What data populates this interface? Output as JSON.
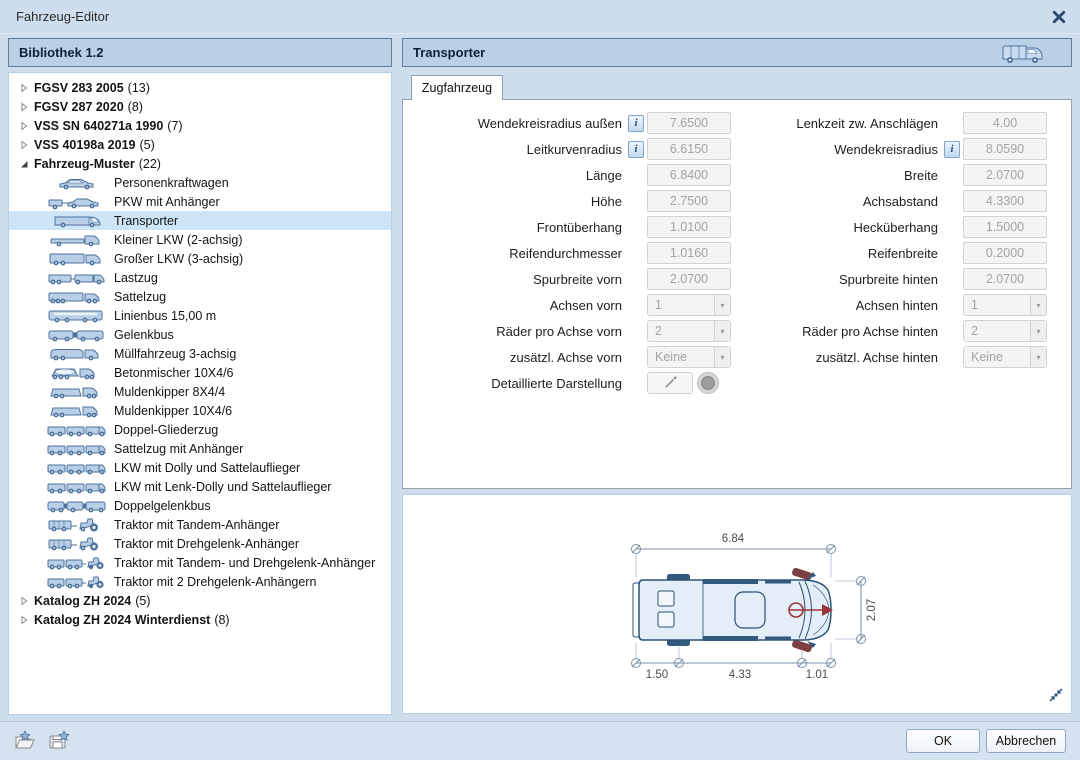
{
  "window": {
    "title": "Fahrzeug-Editor"
  },
  "library": {
    "header": "Bibliothek 1.2",
    "tree": [
      {
        "label": "FGSV 283 2005",
        "count": "(13)",
        "expanded": false
      },
      {
        "label": "FGSV 287 2020",
        "count": "(8)",
        "expanded": false
      },
      {
        "label": "VSS SN 640271a 1990",
        "count": "(7)",
        "expanded": false
      },
      {
        "label": "VSS 40198a 2019",
        "count": "(5)",
        "expanded": false
      },
      {
        "label": "Fahrzeug-Muster",
        "count": "(22)",
        "expanded": true,
        "children": [
          {
            "label": "Personenkraftwagen",
            "icon": "car-icon"
          },
          {
            "label": "PKW mit Anhänger",
            "icon": "car-trailer-icon"
          },
          {
            "label": "Transporter",
            "icon": "van-icon",
            "selected": true
          },
          {
            "label": "Kleiner LKW (2-achsig)",
            "icon": "small-truck-icon"
          },
          {
            "label": "Großer LKW (3-achsig)",
            "icon": "large-truck-icon"
          },
          {
            "label": "Lastzug",
            "icon": "truck-trailer-icon"
          },
          {
            "label": "Sattelzug",
            "icon": "semi-truck-icon"
          },
          {
            "label": "Linienbus 15,00 m",
            "icon": "bus-icon"
          },
          {
            "label": "Gelenkbus",
            "icon": "articulated-bus-icon"
          },
          {
            "label": "Müllfahrzeug 3-achsig",
            "icon": "garbage-truck-icon"
          },
          {
            "label": "Betonmischer 10X4/6",
            "icon": "concrete-mixer-icon"
          },
          {
            "label": "Muldenkipper 8X4/4",
            "icon": "dump-truck-icon"
          },
          {
            "label": "Muldenkipper 10X4/6",
            "icon": "dump-truck-icon"
          },
          {
            "label": "Doppel-Gliederzug",
            "icon": "double-road-train-icon"
          },
          {
            "label": "Sattelzug  mit Anhänger",
            "icon": "double-road-train-icon"
          },
          {
            "label": "LKW mit Dolly und Sattelauflieger",
            "icon": "double-road-train-icon"
          },
          {
            "label": "LKW mit Lenk-Dolly und Sattelauflieger",
            "icon": "double-road-train-icon"
          },
          {
            "label": "Doppelgelenkbus",
            "icon": "double-articulated-bus-icon"
          },
          {
            "label": "Traktor mit Tandem-Anhänger",
            "icon": "tractor-trailer-icon"
          },
          {
            "label": "Traktor mit Drehgelenk-Anhänger",
            "icon": "tractor-trailer-icon"
          },
          {
            "label": "Traktor mit Tandem- und Drehgelenk-Anhänger",
            "icon": "tractor-two-trailers-icon"
          },
          {
            "label": "Traktor mit 2 Drehgelenk-Anhängern",
            "icon": "tractor-two-trailers-icon"
          }
        ]
      },
      {
        "label": "Katalog ZH 2024",
        "count": "(5)",
        "expanded": false
      },
      {
        "label": "Katalog ZH 2024 Winterdienst",
        "count": "(8)",
        "expanded": false
      }
    ]
  },
  "editor": {
    "header": "Transporter",
    "tab": "Zugfahrzeug",
    "fields_left": [
      {
        "label": "Wendekreisradius außen",
        "info": true,
        "type": "input",
        "value": "7.6500"
      },
      {
        "label": "Leitkurvenradius",
        "info": true,
        "type": "input",
        "value": "6.6150"
      },
      {
        "label": "Länge",
        "type": "input",
        "value": "6.8400"
      },
      {
        "label": "Höhe",
        "type": "input",
        "value": "2.7500"
      },
      {
        "label": "Frontüberhang",
        "type": "input",
        "value": "1.0100"
      },
      {
        "label": "Reifendurchmesser",
        "type": "input",
        "value": "1.0160"
      },
      {
        "label": "Spurbreite vorn",
        "type": "input",
        "value": "2.0700"
      },
      {
        "label": "Achsen vorn",
        "type": "select",
        "value": "1"
      },
      {
        "label": "Räder pro Achse vorn",
        "type": "select",
        "value": "2"
      },
      {
        "label": "zusätzl. Achse vorn",
        "type": "select",
        "value": "Keine"
      },
      {
        "label": "Detaillierte Darstellung",
        "type": "detail"
      }
    ],
    "fields_right": [
      {
        "label": "Lenkzeit zw. Anschlägen",
        "type": "input",
        "value": "4.00"
      },
      {
        "label": "Wendekreisradius",
        "info": true,
        "type": "input",
        "value": "8.0590"
      },
      {
        "label": "Breite",
        "type": "input",
        "value": "2.0700"
      },
      {
        "label": "Achsabstand",
        "type": "input",
        "value": "4.3300"
      },
      {
        "label": "Hecküberhang",
        "type": "input",
        "value": "1.5000"
      },
      {
        "label": "Reifenbreite",
        "type": "input",
        "value": "0.2000"
      },
      {
        "label": "Spurbreite hinten",
        "type": "input",
        "value": "2.0700"
      },
      {
        "label": "Achsen hinten",
        "type": "select",
        "value": "1"
      },
      {
        "label": "Räder pro Achse hinten",
        "type": "select",
        "value": "2"
      },
      {
        "label": "zusätzl. Achse hinten",
        "type": "select",
        "value": "Keine"
      }
    ]
  },
  "preview": {
    "length": "6.84",
    "rear_overhang": "1.50",
    "wheelbase": "4.33",
    "front_overhang": "1.01",
    "width": "2.07"
  },
  "footer": {
    "ok": "OK",
    "cancel": "Abbrechen"
  },
  "colors": {
    "dialog_bg": "#cfdeee",
    "header_fill": "#bad0e6",
    "header_border": "#64799b",
    "selection": "#cde5f7",
    "panel_border_blue": "#b9cfe6",
    "panel_border_gray": "#95a0ac",
    "disabled_text": "#a3a3a3",
    "vehicle_outline": "#2e5074",
    "vehicle_fill": "#e4eef8",
    "marker_red": "#9c3438",
    "icon_blue": "#4d739d"
  }
}
